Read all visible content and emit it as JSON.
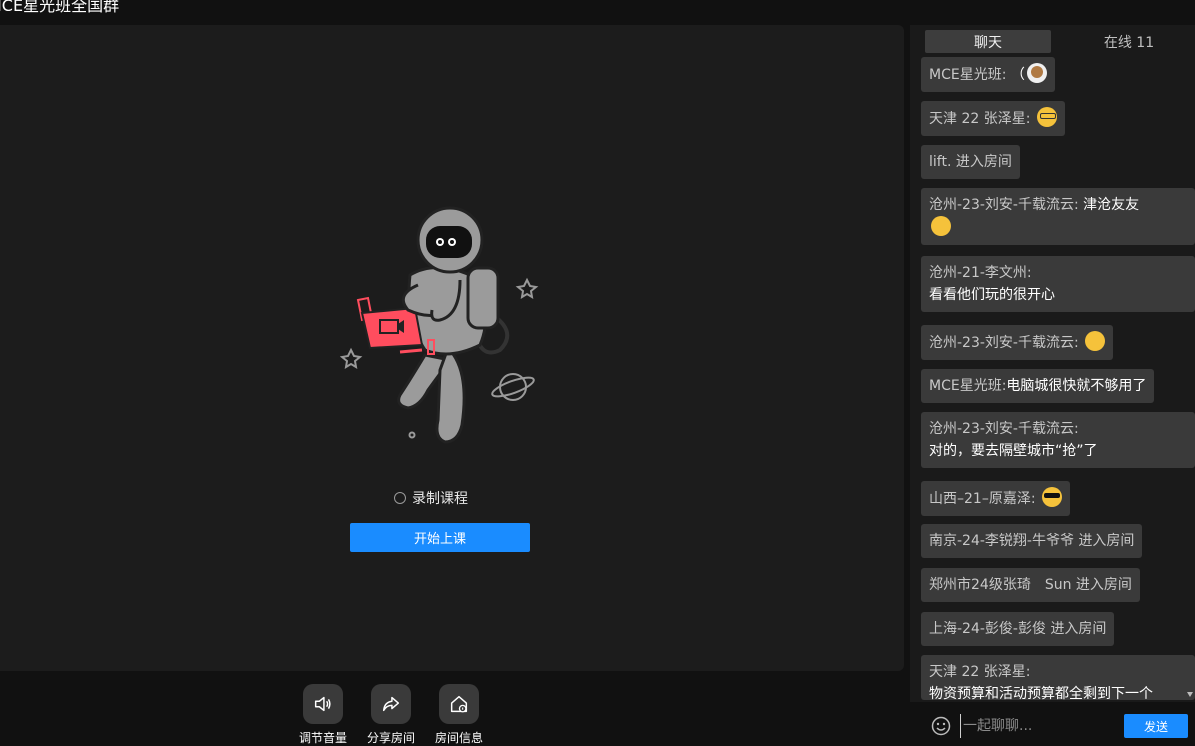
{
  "window": {
    "title": "MCE星光班全国群"
  },
  "stage": {
    "record_label": "录制课程",
    "start_button": "开始上课"
  },
  "toolbar": {
    "volume": "调节音量",
    "share": "分享房间",
    "info": "房间信息"
  },
  "chat": {
    "tab_chat": "聊天",
    "tab_online": "在线 11",
    "messages": [
      {
        "name": "MCE星光班:",
        "text": "（",
        "emoji": "dog-emoji"
      },
      {
        "name": "天津 22 张泽星:",
        "text": "",
        "emoji": "nerd-emoji"
      },
      {
        "name": "lift.",
        "text": "进入房间",
        "emoji": ""
      },
      {
        "name": "沧州-23-刘安-千载流云:",
        "text": "津沧友友",
        "emoji": "smile-emoji"
      },
      {
        "name": "沧州-21-李文州:",
        "text": "看看他们玩的很开心",
        "emoji": ""
      },
      {
        "name": "沧州-23-刘安-千载流云:",
        "text": "",
        "emoji": "thinking-emoji"
      },
      {
        "name": "MCE星光班:",
        "text": "电脑城很快就不够用了",
        "emoji": ""
      },
      {
        "name": "沧州-23-刘安-千载流云:",
        "text": "对的，要去隔壁城市“抢”了",
        "emoji": ""
      },
      {
        "name": "山西–21–原嘉泽:",
        "text": "",
        "emoji": "cool-emoji"
      },
      {
        "name": "南京-24-李锐翔-牛爷爷",
        "text": "进入房间",
        "emoji": ""
      },
      {
        "name": "郑州市24级张琦　Sun",
        "text": "进入房间",
        "emoji": ""
      },
      {
        "name": "上海-24-彭俊-彭俊",
        "text": "进入房间",
        "emoji": ""
      },
      {
        "name": "天津 22 张泽星:",
        "text": "物资预算和活动预算都全剩到下一个",
        "emoji": ""
      }
    ],
    "input_placeholder": "一起聊聊...",
    "send_button": "发送"
  }
}
